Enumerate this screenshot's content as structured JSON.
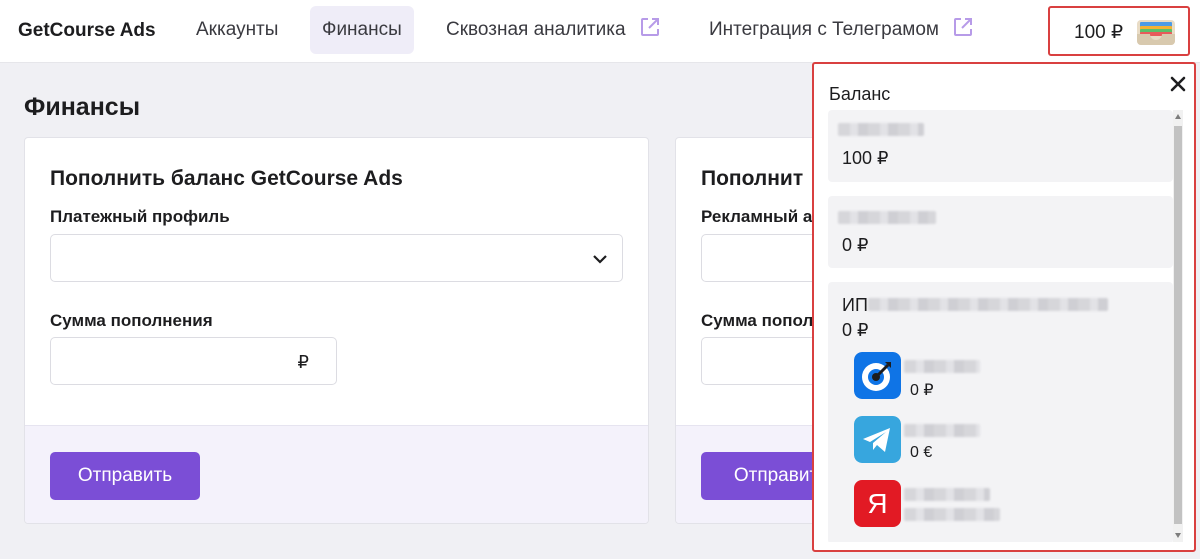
{
  "header": {
    "brand": "GetCourse Ads",
    "nav": [
      {
        "label": "Аккаунты",
        "active": false,
        "external": false
      },
      {
        "label": "Финансы",
        "active": true,
        "external": false
      },
      {
        "label": "Сквозная аналитика",
        "active": false,
        "external": true
      },
      {
        "label": "Интеграция с Телеграмом",
        "active": false,
        "external": true
      }
    ],
    "balance": "100 ₽"
  },
  "page": {
    "title": "Финансы"
  },
  "topup_card": {
    "title": "Пополнить баланс GetCourse Ads",
    "profile_label": "Платежный профиль",
    "profile_value": "",
    "amount_label": "Сумма пополнения",
    "amount_value": "",
    "currency": "₽",
    "submit_label": "Отправить"
  },
  "second_card": {
    "title": "Пополнит",
    "field_label": "Рекламный а",
    "amount_label": "Сумма попол",
    "submit_label": "Отправит"
  },
  "popover": {
    "title": "Баланс",
    "items": [
      {
        "name": "",
        "amount": "100 ₽"
      },
      {
        "name": "",
        "amount": "0 ₽"
      },
      {
        "name_prefix": "ИП",
        "amount": "0 ₽",
        "sub_accounts": [
          {
            "icon": "target-dart-icon",
            "amount": "0 ₽"
          },
          {
            "icon": "telegram-icon",
            "amount": "0 €"
          },
          {
            "icon": "yandex-icon",
            "logo_letter": "Я",
            "amount": ""
          }
        ]
      }
    ]
  },
  "colors": {
    "accent": "#7b4ed6",
    "highlight_border": "#d94040",
    "telegram": "#37a6de",
    "target_blue": "#0f74e6",
    "yandex_red": "#e21a24"
  }
}
